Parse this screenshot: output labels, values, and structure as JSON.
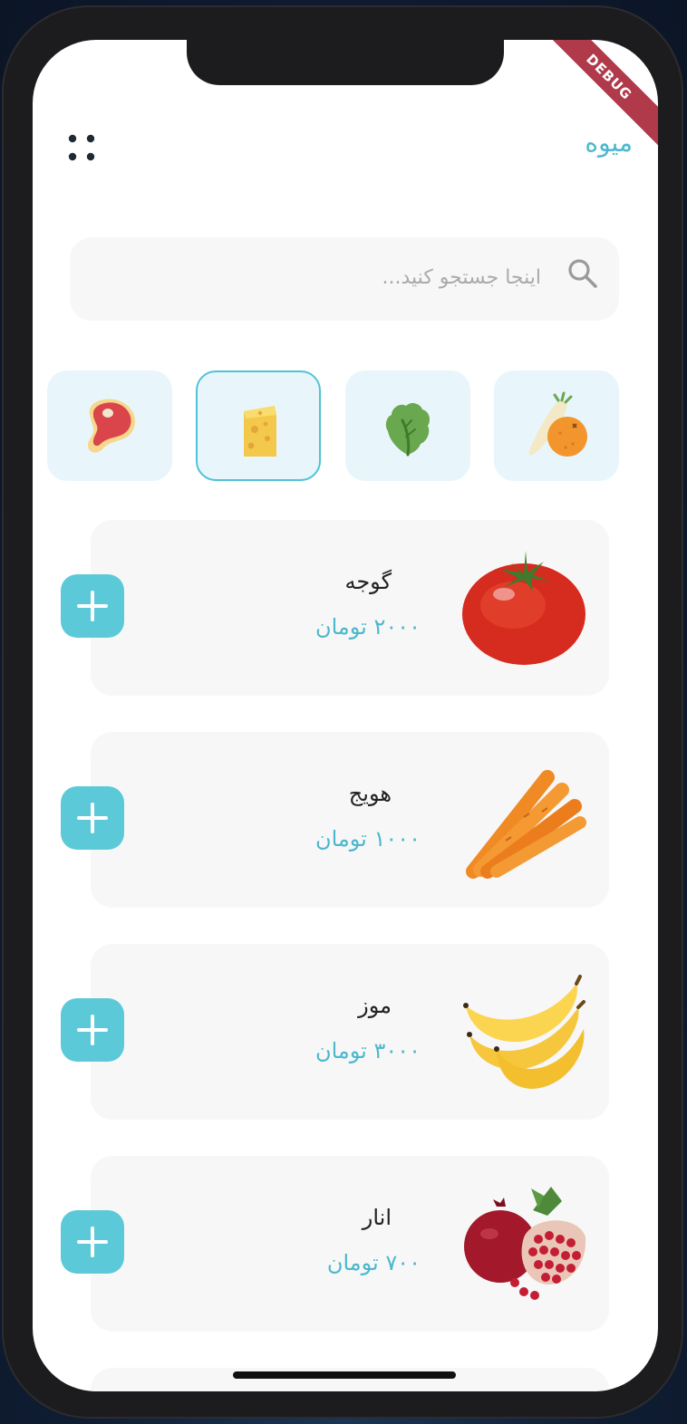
{
  "debug_badge": "DEBUG",
  "header": {
    "title": "میوه",
    "menu_icon": "grid-dots-icon"
  },
  "search": {
    "placeholder": "اینجا جستجو کنید...",
    "value": "",
    "icon": "search-icon"
  },
  "categories": [
    {
      "icon": "meat-icon",
      "active": false
    },
    {
      "icon": "cheese-icon",
      "active": true
    },
    {
      "icon": "lettuce-icon",
      "active": false
    },
    {
      "icon": "fruit-icon",
      "active": false
    }
  ],
  "products": [
    {
      "name": "گوجه",
      "price": "۲۰۰۰ تومان",
      "image": "tomato-image"
    },
    {
      "name": "هویج",
      "price": "۱۰۰۰ تومان",
      "image": "carrot-image"
    },
    {
      "name": "موز",
      "price": "۳۰۰۰ تومان",
      "image": "banana-image"
    },
    {
      "name": "انار",
      "price": "۷۰۰ تومان",
      "image": "pomegranate-image"
    }
  ],
  "colors": {
    "accent": "#4bb8cd",
    "button": "#5cc9d9",
    "card": "#f7f7f7",
    "category_bg": "#e8f6fc"
  }
}
